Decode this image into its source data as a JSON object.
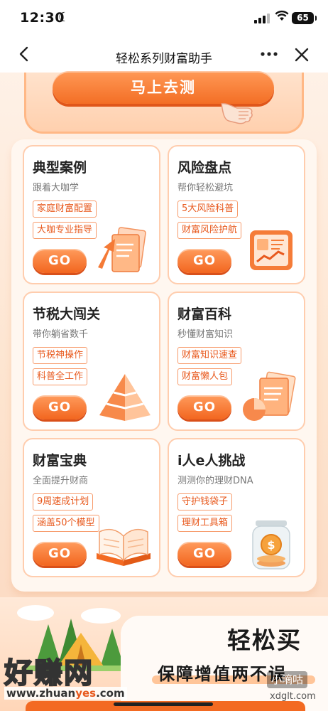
{
  "status_bar": {
    "time": "12:30",
    "battery": "65"
  },
  "nav": {
    "title": "轻松系列财富助手"
  },
  "top_banner": {
    "button_label": "马上去测"
  },
  "cards": [
    {
      "title": "典型案例",
      "subtitle": "跟着大咖学",
      "tags": [
        "家庭财富配置",
        "大咖专业指导"
      ],
      "button": "GO",
      "illustration": "arrow-document-illustration"
    },
    {
      "title": "风险盘点",
      "subtitle": "帮你轻松避坑",
      "tags": [
        "5大风险科普",
        "财富风险护航"
      ],
      "button": "GO",
      "illustration": "chart-board-illustration"
    },
    {
      "title": "节税大闯关",
      "subtitle": "带你躺省数千",
      "tags": [
        "节税神操作",
        "科普全工作"
      ],
      "button": "GO",
      "illustration": "pyramid-illustration"
    },
    {
      "title": "财富百科",
      "subtitle": "秒懂财富知识",
      "tags": [
        "财富知识速查",
        "财富懒人包"
      ],
      "button": "GO",
      "illustration": "documents-pie-illustration"
    },
    {
      "title": "财富宝典",
      "subtitle": "全面提升财商",
      "tags": [
        "9周速成计划",
        "涵盖50个模型"
      ],
      "button": "GO",
      "illustration": "open-book-illustration"
    },
    {
      "title": "i人e人挑战",
      "subtitle": "测测你的理财DNA",
      "tags": [
        "守护钱袋子",
        "理财工具箱"
      ],
      "button": "GO",
      "illustration": "coin-jar-illustration"
    }
  ],
  "bottom_banner": {
    "title": "轻松买",
    "subtitle": "保障增值两不误"
  },
  "watermark": {
    "site_name": "好赚网",
    "url_prefix": "www.zhuan",
    "url_highlight": "yes",
    "url_suffix": ".com",
    "badge": "小嘀咕",
    "badge_url": "xdglt.com"
  },
  "colors": {
    "accent": "#f36e25",
    "card_border": "#ffcdae",
    "tag_text": "#e8591d"
  }
}
